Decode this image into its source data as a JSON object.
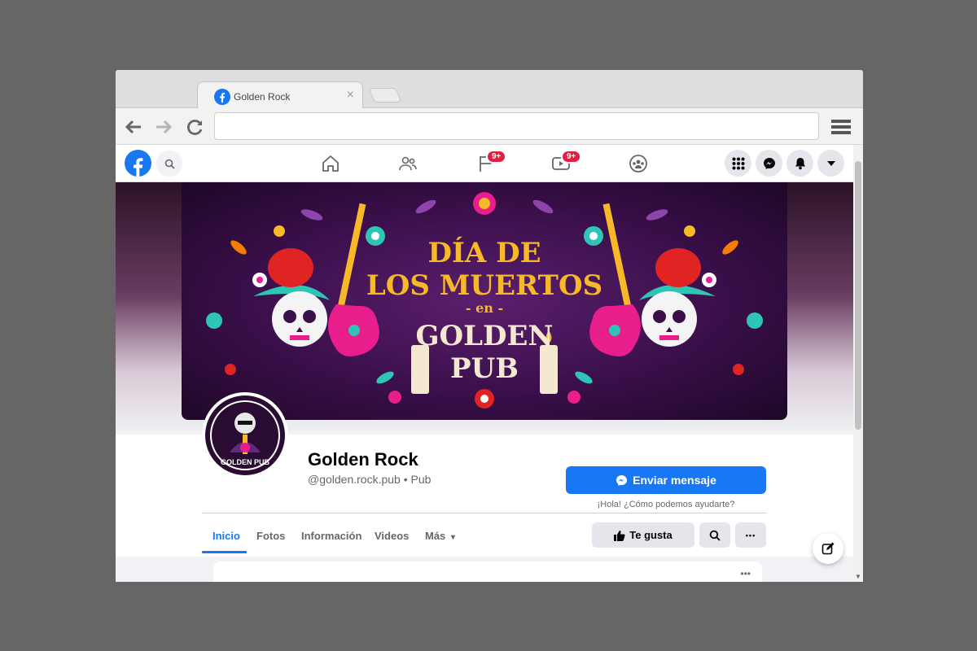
{
  "browser": {
    "tab_title": "Golden Rock",
    "close_glyph": "×",
    "url": ""
  },
  "fb_nav": {
    "pages_badge": "9+",
    "watch_badge": "9+"
  },
  "cover": {
    "line1": "DÍA DE",
    "line2": "LOS MUERTOS",
    "line3": "- en -",
    "line4": "GOLDEN",
    "line5": "PUB",
    "avatar_text": "GOLDEN PUB"
  },
  "profile": {
    "name": "Golden Rock",
    "handle": "@golden.rock.pub • Pub",
    "message_button": "Enviar mensaje",
    "message_hint": "¡Hola! ¿Cómo podemos ayudarte?",
    "tabs": [
      {
        "label": "Inicio"
      },
      {
        "label": "Fotos"
      },
      {
        "label": "Información"
      },
      {
        "label": "Videos"
      },
      {
        "label": "Más"
      }
    ],
    "like_button": "Te gusta",
    "more_glyph": "•••",
    "more_caret": "▾"
  },
  "colors": {
    "facebook_blue": "#1877f2",
    "badge_red": "#e41e3f",
    "cover_purple": "#3a0f4a",
    "title_gold": "#f7b928"
  }
}
